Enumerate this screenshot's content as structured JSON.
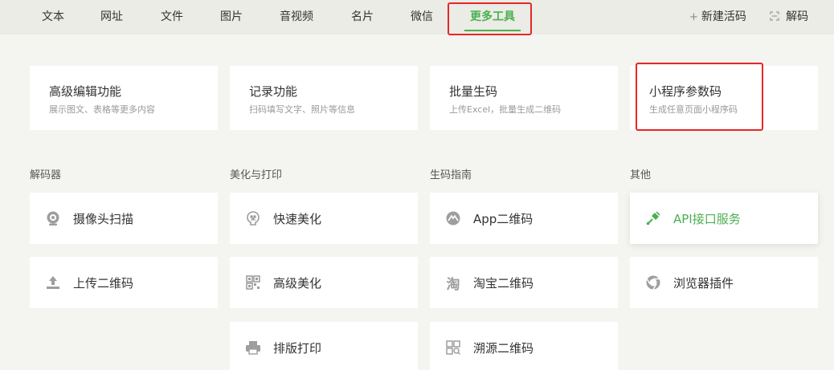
{
  "nav": {
    "tabs": [
      {
        "label": "文本"
      },
      {
        "label": "网址"
      },
      {
        "label": "文件"
      },
      {
        "label": "图片"
      },
      {
        "label": "音视频"
      },
      {
        "label": "名片"
      },
      {
        "label": "微信"
      },
      {
        "label": "更多工具",
        "active": true
      }
    ],
    "new_code": {
      "icon": "plus-icon",
      "label": "新建活码"
    },
    "decode": {
      "icon": "scan-icon",
      "label": "解码"
    }
  },
  "features": [
    {
      "title": "高级编辑功能",
      "desc": "展示图文、表格等更多内容"
    },
    {
      "title": "记录功能",
      "desc": "扫码填写文字、照片等信息"
    },
    {
      "title": "批量生码",
      "desc": "上传Excel，批量生成二维码"
    },
    {
      "title": "小程序参数码",
      "desc": "生成任意页面小程序码"
    }
  ],
  "sections": {
    "decoder": {
      "title": "解码器",
      "items": [
        {
          "icon": "camera-icon",
          "label": "摄像头扫描"
        },
        {
          "icon": "upload-icon",
          "label": "上传二维码"
        }
      ]
    },
    "beautify": {
      "title": "美化与打印",
      "items": [
        {
          "icon": "brain-icon",
          "label": "快速美化"
        },
        {
          "icon": "qr-grid-icon",
          "label": "高级美化"
        },
        {
          "icon": "printer-icon",
          "label": "排版打印"
        }
      ]
    },
    "guide": {
      "title": "生码指南",
      "items": [
        {
          "icon": "app-icon",
          "label": "App二维码"
        },
        {
          "icon": "taobao-icon",
          "label": "淘宝二维码"
        },
        {
          "icon": "trace-icon",
          "label": "溯源二维码"
        }
      ]
    },
    "other": {
      "title": "其他",
      "items": [
        {
          "icon": "plug-icon",
          "label": "API接口服务"
        },
        {
          "icon": "browser-icon",
          "label": "浏览器插件"
        }
      ]
    }
  },
  "colors": {
    "accent": "#4caf50",
    "highlight": "#e8262a",
    "background": "#f4f5f0",
    "nav_background": "#eaece5"
  }
}
